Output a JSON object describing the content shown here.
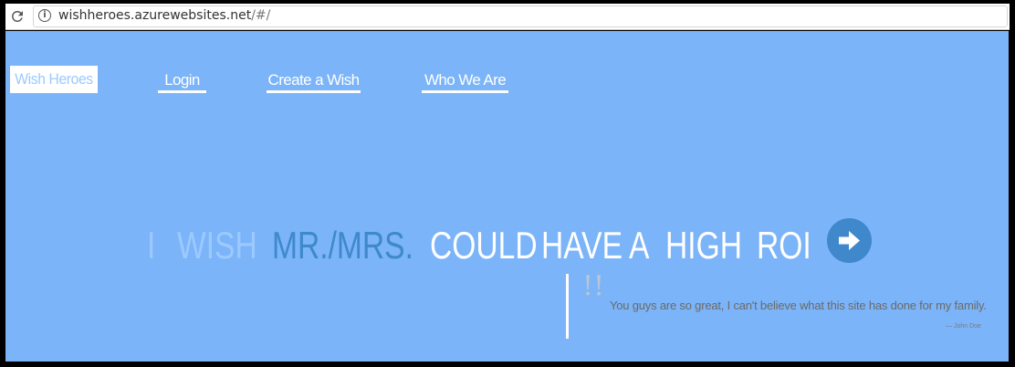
{
  "browser": {
    "url_host": "wishheroes.azurewebsites.net",
    "url_path": "/#/"
  },
  "nav": {
    "brand": "Wish Heroes",
    "links": [
      "Login",
      "Create a Wish",
      "Who We Are"
    ]
  },
  "hero": {
    "i": "I",
    "wish": "WISH",
    "name": "MR./MRS.",
    "could": "COULD",
    "have": "HAVE",
    "a": "A",
    "high": "HIGH",
    "roi": "ROI"
  },
  "testimonial": {
    "quote_mark": "!!",
    "text": "You guys are so great, I can't believe what this site has done for my family.",
    "author": "— John Doe"
  },
  "colors": {
    "background": "#7bb4f8",
    "accent": "#3f88cc",
    "pale": "#9cc9ff",
    "white": "#ffffff"
  }
}
